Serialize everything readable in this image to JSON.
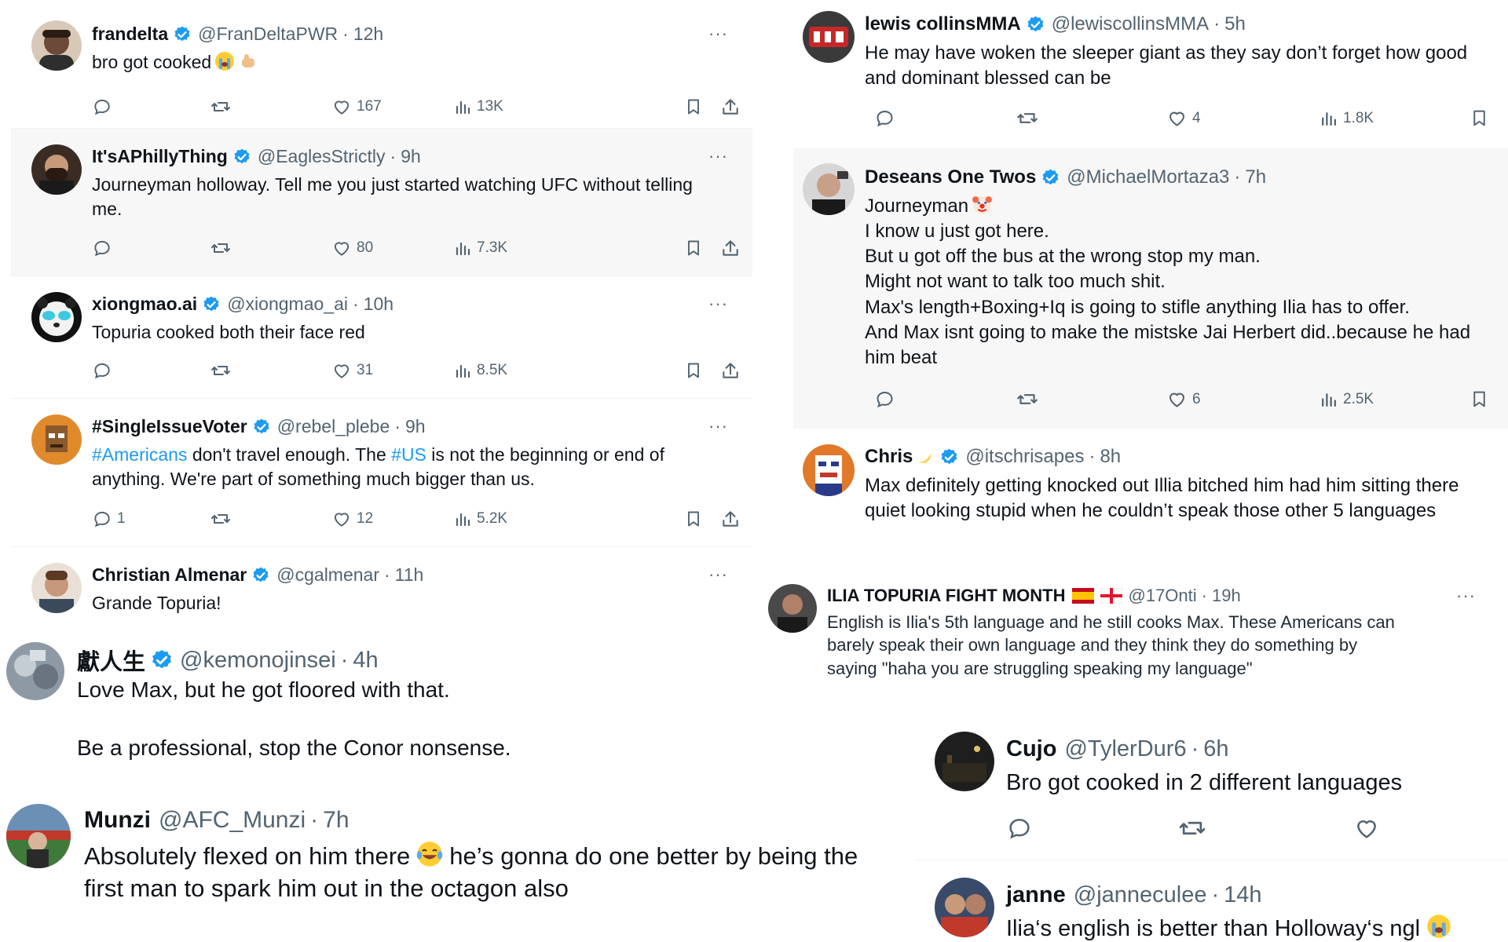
{
  "panels": {
    "top_left": {
      "posts": [
        {
          "name": "frandelta",
          "handle": "@FranDeltaPWR",
          "time": "12h",
          "lines": [
            "bro got cooked"
          ],
          "stats": {
            "replies": "",
            "reposts": "",
            "likes": "167",
            "views": "13K"
          },
          "avatar_color": "#6b4a3a"
        },
        {
          "name": "It'sAPhillyThing",
          "handle": "@EaglesStrictly",
          "time": "9h",
          "lines": [
            "Journeyman holloway.  Tell me you just started watching UFC without telling",
            "me."
          ],
          "stats": {
            "replies": "",
            "reposts": "",
            "likes": "80",
            "views": "7.3K"
          },
          "avatar_color": "#3a2c24"
        },
        {
          "name": "xiongmao.ai",
          "handle": "@xiongmao_ai",
          "time": "10h",
          "lines": [
            "Topuria  cooked both their face red"
          ],
          "stats": {
            "replies": "",
            "reposts": "",
            "likes": "31",
            "views": "8.5K"
          },
          "avatar_color": "#111111"
        },
        {
          "name": "#SingleIssueVoter",
          "handle": "@rebel_plebe",
          "time": "9h",
          "line1_parts": [
            "#Americans",
            " don't travel enough. The ",
            "#US",
            " is not the beginning or end of"
          ],
          "lines": [
            "anything. We're part of something much bigger than us."
          ],
          "stats": {
            "replies": "1",
            "reposts": "",
            "likes": "12",
            "views": "5.2K"
          },
          "avatar_color": "#e08a2c"
        },
        {
          "name": "Christian Almenar",
          "handle": "@cgalmenar",
          "time": "11h",
          "lines": [
            "Grande Topuria!"
          ],
          "avatar_color": "#8a6a50"
        }
      ]
    },
    "top_right": {
      "posts": [
        {
          "name": "lewis collinsMMA",
          "handle": "@lewiscollinsMMA",
          "time": "5h",
          "lines": [
            "He may have woken the sleeper giant as they say don’t forget how good",
            "and dominant blessed can be"
          ],
          "stats": {
            "replies": "",
            "reposts": "",
            "likes": "4",
            "views": "1.8K"
          },
          "avatar_color": "#c62828"
        },
        {
          "name": "Deseans One Twos",
          "handle": "@MichaelMortaza3",
          "time": "7h",
          "lines": [
            "Journeyman",
            "I know u just got here.",
            "But u got off the bus at the wrong stop my man.",
            "Might not want to talk too much shit.",
            "Max's length+Boxing+Iq  is going to stifle anything Ilia has to offer.",
            "And Max isnt going to make the mistske Jai Herbert did..because he had",
            "him beat"
          ],
          "stats": {
            "replies": "",
            "reposts": "",
            "likes": "6",
            "views": "2.5K"
          },
          "avatar_color": "#9e9e9e"
        },
        {
          "name": "Chris",
          "handle": "@itschrisapes",
          "time": "8h",
          "lines": [
            "Max definitely getting knocked out Illia bitched him had him sitting there",
            "quiet looking stupid when he couldn’t speak those other 5 languages"
          ],
          "avatar_color": "#e0792a"
        }
      ]
    },
    "mid_right": {
      "name": "ILIA TOPURIA FIGHT MONTH",
      "handle": "@17Onti",
      "time": "19h",
      "lines": [
        "English is Ilia's 5th language and he still cooks Max. These Americans can",
        "barely speak their own language and they think they do something by",
        "saying \"haha you are struggling speaking my language\""
      ],
      "avatar_color": "#4a4a4a"
    },
    "bottom_left_a": {
      "name": "獻人生",
      "handle": "@kemonojinsei",
      "time": "4h",
      "lines": [
        "Love Max, but he got floored with that.",
        "",
        "Be a professional, stop the Conor nonsense."
      ],
      "avatar_color": "#8d9aa6"
    },
    "bottom_left_b": {
      "name": "Munzi",
      "handle": "@AFC_Munzi",
      "time": "7h",
      "line1": "Absolutely flexed on him there",
      "line1_rest": "he’s gonna do one better by being the",
      "lines": [
        "first man to spark him out  in the octagon also"
      ],
      "avatar_color": "#5d7a9a"
    },
    "bottom_right_a": {
      "name": "Cujo",
      "handle": "@TylerDur6",
      "time": "6h",
      "lines": [
        "Bro got cooked in 2 different languages"
      ],
      "avatar_color": "#1e1e1e"
    },
    "bottom_right_b": {
      "name": "janne",
      "handle": "@janneculee",
      "time": "14h",
      "lines": [
        "Ilia‘s english is better than Holloway‘s ngl"
      ],
      "avatar_color": "#3a4a6a"
    }
  },
  "colors": {
    "verified": "#1d9bf0",
    "hashtag": "#1d9bf0",
    "muted": "#536471"
  }
}
